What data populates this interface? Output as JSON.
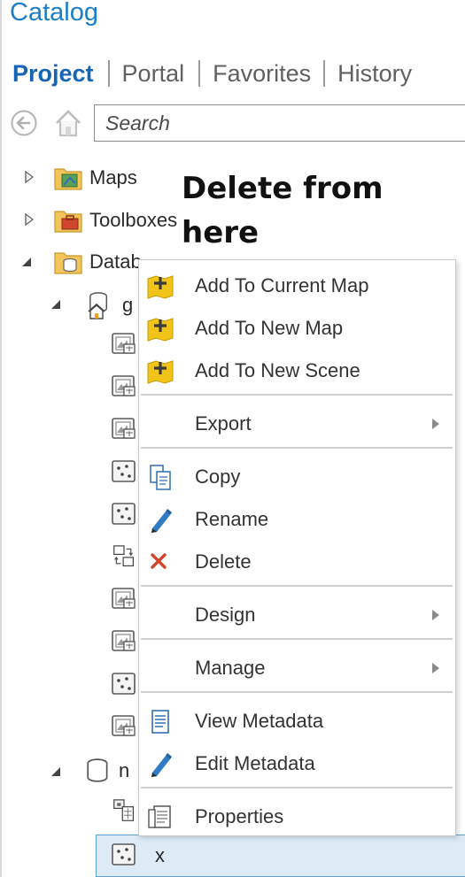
{
  "panel": {
    "title": "Catalog"
  },
  "tabs": [
    {
      "label": "Project",
      "active": true
    },
    {
      "label": "Portal",
      "active": false
    },
    {
      "label": "Favorites",
      "active": false
    },
    {
      "label": "History",
      "active": false
    }
  ],
  "search": {
    "placeholder": "Search"
  },
  "tree": {
    "maps_label": "Maps",
    "toolboxes_label": "Toolboxes",
    "databases_label": "Datab",
    "db1_label": "g",
    "db2_label": "n",
    "selected_item_label": "x"
  },
  "annotation": {
    "line1": "Delete from",
    "line2": "here"
  },
  "context_menu": {
    "add_current_map": "Add To Current Map",
    "add_new_map": "Add To New Map",
    "add_new_scene": "Add To New Scene",
    "export": "Export",
    "copy": "Copy",
    "rename": "Rename",
    "delete": "Delete",
    "design": "Design",
    "manage": "Manage",
    "view_metadata": "View Metadata",
    "edit_metadata": "Edit Metadata",
    "properties": "Properties"
  },
  "colors": {
    "accent": "#1b7ec6",
    "delete_red": "#d2452d",
    "selection_bg": "#ddebf7",
    "selection_border": "#5aa2da"
  }
}
